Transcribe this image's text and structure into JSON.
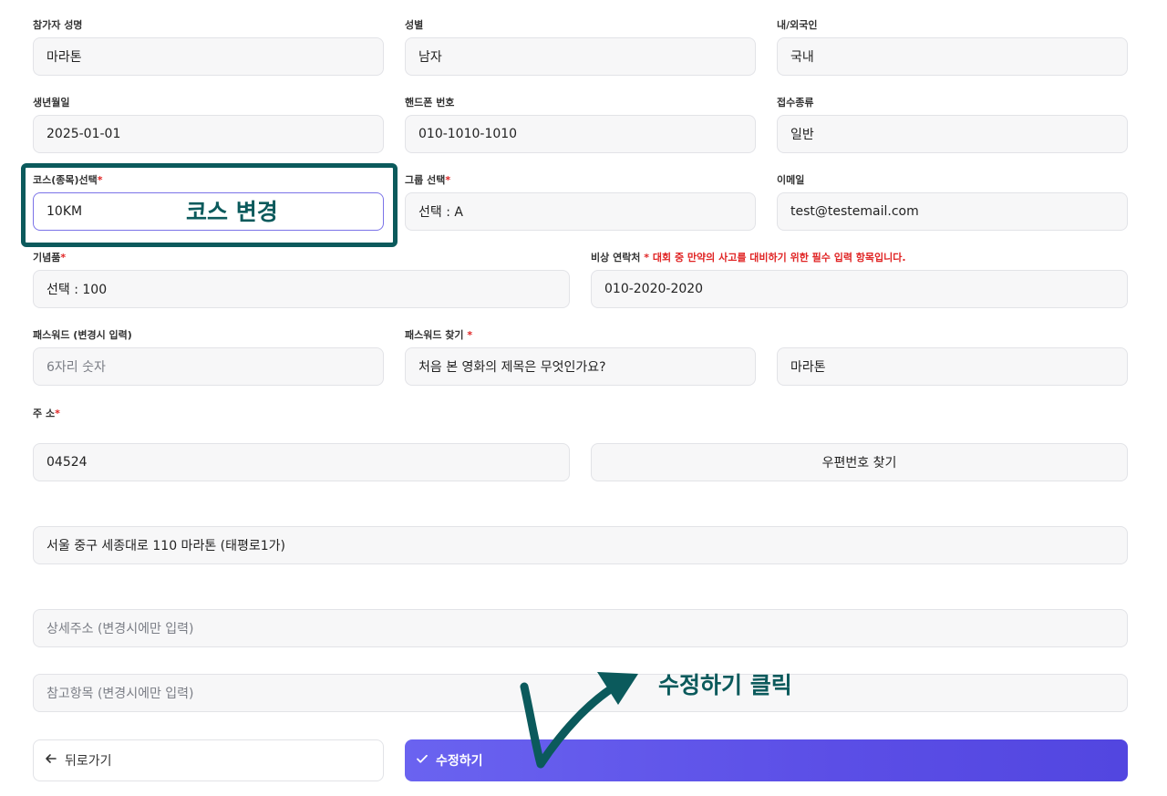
{
  "form": {
    "name": {
      "label": "참가자 성명",
      "value": "마라톤"
    },
    "gender": {
      "label": "성별",
      "value": "남자"
    },
    "nationality": {
      "label": "내/외국인",
      "value": "국내"
    },
    "birth": {
      "label": "생년월일",
      "value": "2025-01-01"
    },
    "phone": {
      "label": "핸드폰 번호",
      "value": "010-1010-1010"
    },
    "reg_type": {
      "label": "접수종류",
      "value": "일반"
    },
    "course": {
      "label": "코스(종목)선택",
      "required": "*",
      "value": "10KM"
    },
    "group": {
      "label": "그룹 선택",
      "required": "*",
      "value": "선택 : A"
    },
    "email": {
      "label": "이메일",
      "value": "test@testemail.com"
    },
    "souvenir": {
      "label": "기념품",
      "required": "*",
      "value": "선택 : 100"
    },
    "emergency": {
      "label": "비상 연락처",
      "required": "*",
      "note": "대회 중 만약의 사고를 대비하기 위한 필수 입력 항목입니다.",
      "value": "010-2020-2020"
    },
    "password": {
      "label": "패스워드 (변경시 입력)",
      "placeholder": "6자리 숫자"
    },
    "pw_question": {
      "label": "패스워드 찾기",
      "required": "*",
      "value": "처음 본 영화의 제목은 무엇인가요?"
    },
    "pw_answer": {
      "value": "마라톤"
    },
    "address": {
      "label": "주 소",
      "required": "*",
      "zipcode": "04524",
      "find_button": "우편번호 찾기",
      "road": "서울 중구 세종대로 110 마라톤 (태평로1가)",
      "detail_placeholder": "상세주소 (변경시에만 입력)",
      "ref_placeholder": "참고항목 (변경시에만 입력)"
    }
  },
  "buttons": {
    "back": "뒤로가기",
    "submit": "수정하기"
  },
  "annotations": {
    "course_change": "코스 변경",
    "click_submit": "수정하기 클릭"
  },
  "colors": {
    "accent": "#5b4ee6",
    "annotation": "#0b5a5c",
    "required": "#e02424"
  }
}
